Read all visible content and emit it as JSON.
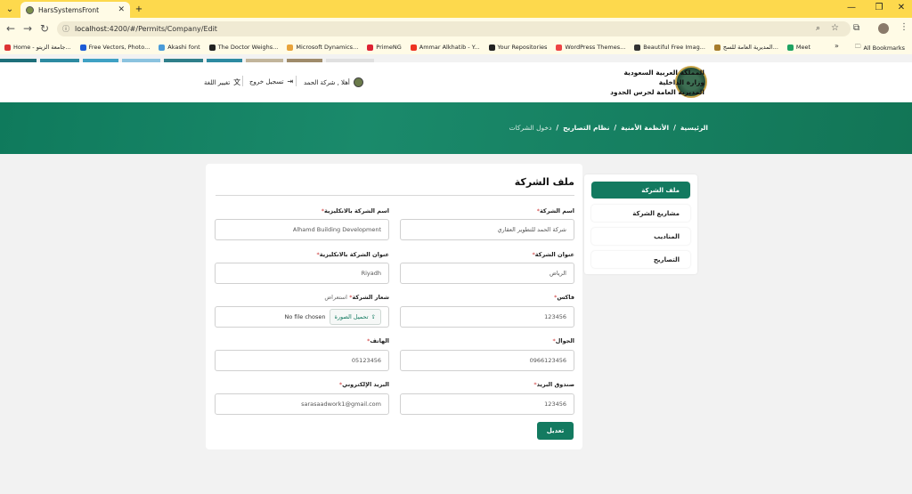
{
  "browser": {
    "tab_title": "HarsSystemsFront",
    "url_host": "localhost",
    "url_path": ":4200/#/Permits/Company/Edit",
    "all_bookmarks": "All Bookmarks",
    "bookmarks": [
      {
        "label": "Home - جامعة الزيتو...",
        "color": "#d33"
      },
      {
        "label": "Free Vectors, Photo...",
        "color": "#1c5bd6"
      },
      {
        "label": "Akashi font",
        "color": "#4a9bd8"
      },
      {
        "label": "The Doctor Weighs...",
        "color": "#222"
      },
      {
        "label": "Microsoft Dynamics...",
        "color": "#e8a33a"
      },
      {
        "label": "PrimeNG",
        "color": "#dd2233"
      },
      {
        "label": "Ammar Alkhatib - Y...",
        "color": "#e32"
      },
      {
        "label": "Your Repositories",
        "color": "#222"
      },
      {
        "label": "WordPress Themes...",
        "color": "#e44"
      },
      {
        "label": "Beautiful Free Imag...",
        "color": "#333"
      },
      {
        "label": "المديرية العامة للسج...",
        "color": "#a67c2c"
      },
      {
        "label": "Meet",
        "color": "#1ea362"
      }
    ]
  },
  "stripes": [
    "#1e6f7a",
    "#2d8aa1",
    "#3fa1c4",
    "#8bc3df",
    "#2f7f8a",
    "#2d8aa1",
    "#c2b59b",
    "#9f8b6a",
    "#e0e0e0"
  ],
  "header": {
    "line1": "المملكة العربية السعودية",
    "line2": "وزارة الداخلية",
    "line3": "المديرية العامة لحرس الحدود",
    "greeting": "أهلا , شركة الحمد",
    "logout": "تسجيل خروج",
    "language": "تغيير اللغة"
  },
  "breadcrumb": {
    "home": "الرئيسية",
    "sep": "/",
    "security": "الأنظمة الأمنية",
    "permits": "نظام التصاريح",
    "current": "دخول الشركات"
  },
  "sidebar": {
    "items": [
      {
        "label": "ملف الشركة",
        "active": true
      },
      {
        "label": "مشاريع الشركة",
        "active": false
      },
      {
        "label": "المناديب",
        "active": false
      },
      {
        "label": "التصاريح",
        "active": false
      }
    ]
  },
  "form": {
    "title": "ملف الشركة",
    "required_mark": "*",
    "name_ar_label": "اسم الشركة",
    "name_ar_value": "شركة الحمد للتطوير العقاري",
    "name_en_label": "اسم الشركة بالانكليزية",
    "name_en_value": "Alhamd Building Development",
    "address_ar_label": "عنوان الشركة",
    "address_ar_value": "الرياض",
    "address_en_label": "عنوان الشركة بالانكليزية",
    "address_en_value": "Riyadh",
    "fax_label": "فاكس",
    "fax_value": "123456",
    "logo_label": "شعار الشركة",
    "logo_hint": "استعراض",
    "upload_label": "تحميل الصورة",
    "no_file": "No file chosen",
    "mobile_label": "الجوال",
    "mobile_value": "0966123456",
    "phone_label": "الهاتف",
    "phone_value": "05123456",
    "pobox_label": "صندوق البريد",
    "pobox_value": "123456",
    "email_label": "البريد الإلكتروني",
    "email_value": "sarasaadwork1@gmail.com",
    "submit_label": "تعديل"
  }
}
